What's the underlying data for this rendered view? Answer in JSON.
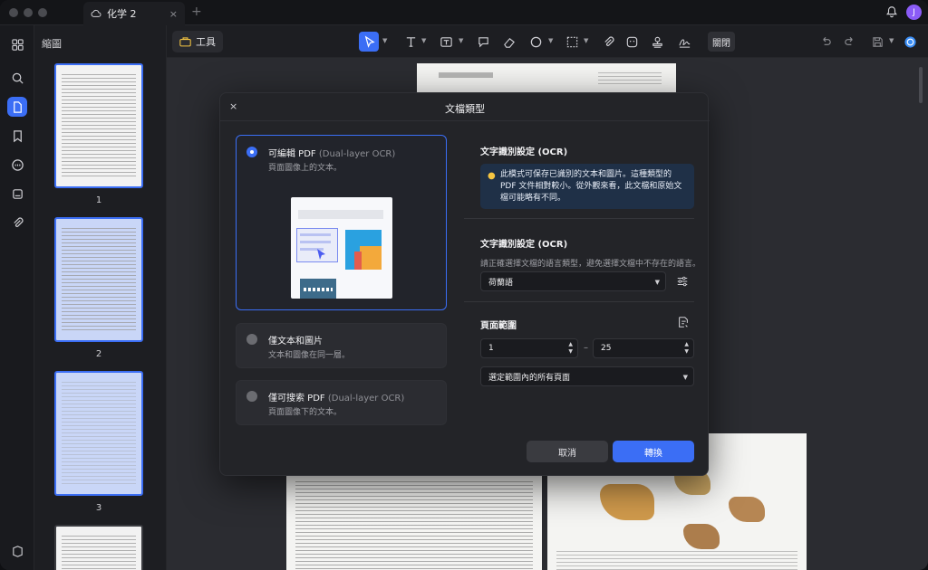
{
  "window": {
    "tab_title": "化学 2",
    "tab_close": "×",
    "new_tab": "+",
    "avatar_initial": "J"
  },
  "sidebar": {
    "title": "縮圖",
    "pages": [
      "1",
      "2",
      "3"
    ]
  },
  "toolbar": {
    "tools_label": "工具",
    "close_label": "關閉"
  },
  "modal": {
    "close": "×",
    "title": "文檔類型",
    "options": [
      {
        "title": "可編輯 PDF",
        "subtitle": "(Dual-layer OCR)",
        "desc": "頁面圖像上的文本。",
        "selected": true
      },
      {
        "title": "僅文本和圖片",
        "subtitle": "",
        "desc": "文本和圖像在同一層。",
        "selected": false
      },
      {
        "title": "僅可搜索 PDF",
        "subtitle": "(Dual-layer OCR)",
        "desc": "頁面圖像下的文本。",
        "selected": false
      }
    ],
    "ocr_section_title": "文字識別設定 (OCR)",
    "ocr_info": "此模式可保存已識別的文本和圖片。這種類型的 PDF 文件相對較小。從外觀來看，此文檔和原始文檔可能略有不同。",
    "lang_section_title": "文字識別設定 (OCR)",
    "lang_hint": "請正確選擇文檔的語言類型，避免選擇文檔中不存在的語言。",
    "language": "荷蘭語",
    "page_range_title": "頁面範圍",
    "range_from": "1",
    "range_to": "25",
    "range_dash": "–",
    "range_mode": "選定範圍內的所有頁面",
    "cancel_label": "取消",
    "convert_label": "轉換"
  },
  "colors": {
    "accent": "#3b6ef5",
    "info_bg": "#1f3047"
  }
}
